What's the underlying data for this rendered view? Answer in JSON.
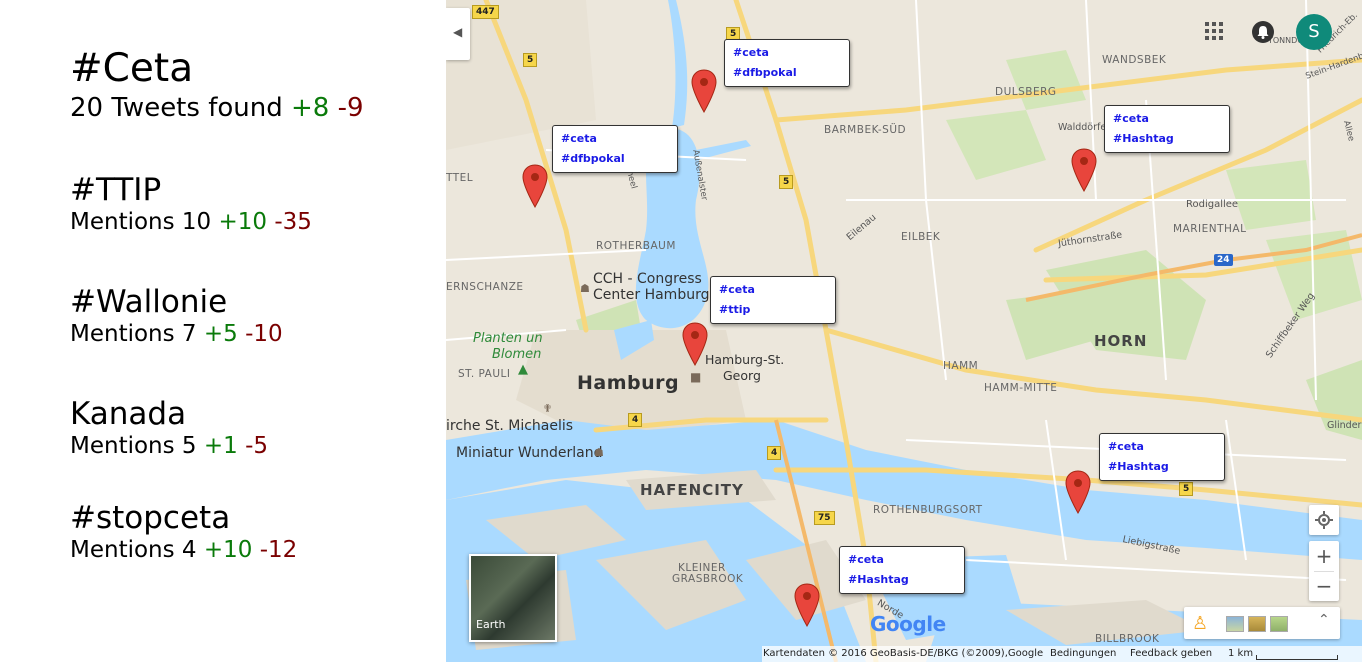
{
  "topics": [
    {
      "title": "#Ceta",
      "stat": "20 Tweets found",
      "plus": "+8",
      "minus": "-9"
    },
    {
      "title": "#TTIP",
      "stat": "Mentions 10",
      "plus": "+10",
      "minus": "-35"
    },
    {
      "title": "#Wallonie",
      "stat": "Mentions 7",
      "plus": "+5",
      "minus": "-10"
    },
    {
      "title": "Kanada",
      "stat": "Mentions 5",
      "plus": "+1",
      "minus": "-5"
    },
    {
      "title": "#stopceta",
      "stat": "Mentions 4",
      "plus": "+10",
      "minus": "-12"
    }
  ],
  "map": {
    "labels": {
      "wandsbek": "WANDSBEK",
      "dulsberg": "DULSBERG",
      "barmbek": "BARMBEK-SÜD",
      "eilbek": "EILBEK",
      "marienthal": "MARIENTHAL",
      "rotherbaum": "ROTHERBAUM",
      "horn": "HORN",
      "hamm": "HAMM",
      "hammmitte": "HAMM-MITTE",
      "stpauli": "ST. PAULI",
      "hafencity": "HAFENCITY",
      "rothenburgsort": "ROTHENBURGSORT",
      "kleiner": "KLEINER",
      "grasbrook": "GRASBROOK",
      "billbrook": "BILLBROOK",
      "hamburg": "Hamburg",
      "hbfline1": "Hamburg-St.",
      "hbfline2": "Georg",
      "cch1": "CCH - Congress",
      "cch2": "Center Hamburg",
      "park1": "Planten un",
      "park2": "Blomen",
      "michaelis": "irche St. Michaelis",
      "miniatur": "Miniatur Wunderland",
      "schanze": "ERNSCHANZE",
      "ttel": "TTEL",
      "rodigallee": "Rodigallee",
      "juthorn": "Jüthornstraße",
      "liebig": "Liebigstraße",
      "schiffbeker": "Schiffbeker Weg",
      "eilenau": "Eilenau",
      "walddoerfer": "Walddörfer",
      "glinder": "Glinder",
      "nordkanal": "Norde",
      "friedrich": "Friedrich-Eb.",
      "steinhagen": "Stein-Hardenber",
      "tonndorf": "TONNDOR",
      "scheel": "Scheel",
      "aussen": "Außenalster",
      "allee": "Allee"
    },
    "roadNumbers": [
      "447",
      "5",
      "5",
      "5",
      "4",
      "4",
      "75",
      "5",
      "24"
    ],
    "infoWindows": [
      {
        "line1": "#ceta",
        "line2": "#dfbpokal"
      },
      {
        "line1": "#ceta",
        "line2": "#dfbpokal"
      },
      {
        "line1": "#ceta",
        "line2": "#Hashtag"
      },
      {
        "line1": "#ceta",
        "line2": "#ttip"
      },
      {
        "line1": "#ceta",
        "line2": "#Hashtag"
      },
      {
        "line1": "#ceta",
        "line2": "#Hashtag"
      }
    ],
    "earthLabel": "Earth",
    "googleLogo": "Google",
    "avatarLetter": "S",
    "footer": {
      "attribution": "Kartendaten © 2016 GeoBasis-DE/BKG (©2009),Google",
      "terms": "Bedingungen",
      "feedback": "Feedback geben",
      "scale": "1 km"
    },
    "zoomIn": "+",
    "zoomOut": "−",
    "icons": [
      "apps-grid-icon",
      "notifications-icon",
      "location-icon",
      "pegman-icon",
      "collapse-chevron-icon",
      "expand-chevron-icon"
    ]
  }
}
